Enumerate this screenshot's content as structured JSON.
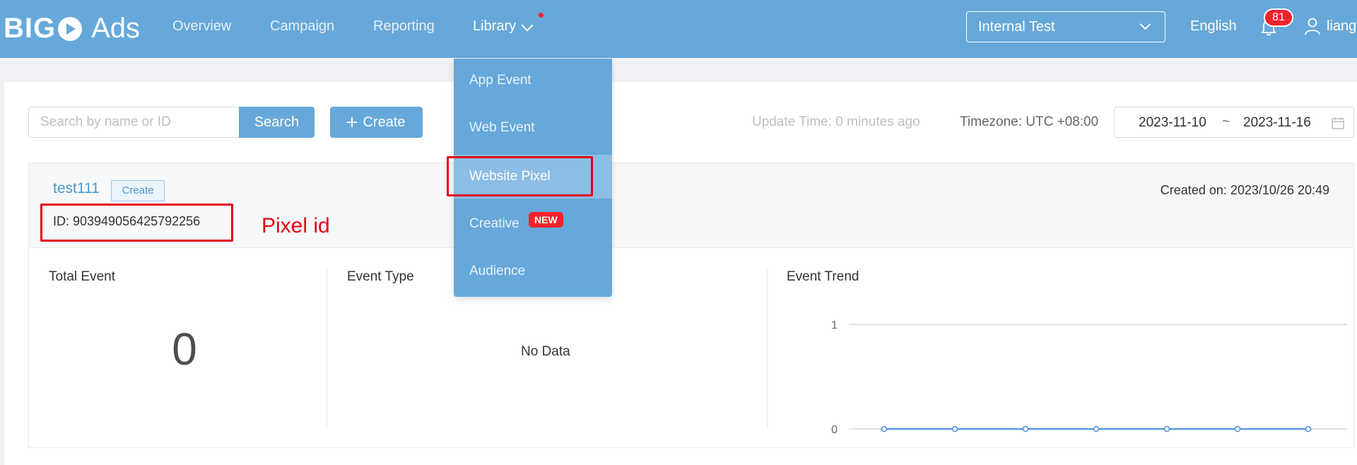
{
  "header": {
    "logo_bold": "BIG",
    "logo_bold_end": "",
    "logo_ads": "Ads",
    "nav": [
      "Overview",
      "Campaign",
      "Reporting",
      "Library"
    ],
    "account": "Internal Test",
    "language": "English",
    "notification_count": "81",
    "user_name": "liangz"
  },
  "library_menu": {
    "items": [
      "App Event",
      "Web Event",
      "Website Pixel",
      "Creative",
      "Audience"
    ],
    "new_badge": "NEW"
  },
  "toolbar": {
    "search_placeholder": "Search by name or ID",
    "search_button": "Search",
    "create_button": "Create",
    "update_time": "Update Time: 0 minutes ago",
    "timezone": "Timezone: UTC +08:00",
    "date_start": "2023-11-10",
    "date_separator": "~",
    "date_end": "2023-11-16"
  },
  "pixel": {
    "name": "test111",
    "create_tag": "Create",
    "id_text": "ID: 903949056425792256",
    "created_on": "Created on: 2023/10/26 20:49"
  },
  "stats": {
    "total_event_title": "Total Event",
    "total_event_value": "0",
    "event_type_title": "Event Type",
    "event_type_empty": "No Data",
    "event_trend_title": "Event Trend"
  },
  "annotation": {
    "label": "Pixel id"
  },
  "colors": {
    "brand": "#66a8d9",
    "annotation": "#e60012",
    "trend_line": "#4a8fe0"
  },
  "chart_data": {
    "type": "line",
    "title": "Event Trend",
    "xlabel": "",
    "ylabel": "",
    "y_ticks": [
      "0",
      "1"
    ],
    "ylim": [
      0,
      1
    ],
    "series": [
      {
        "values": [
          0,
          0,
          0,
          0,
          0,
          0,
          0
        ]
      }
    ],
    "grid": true
  }
}
